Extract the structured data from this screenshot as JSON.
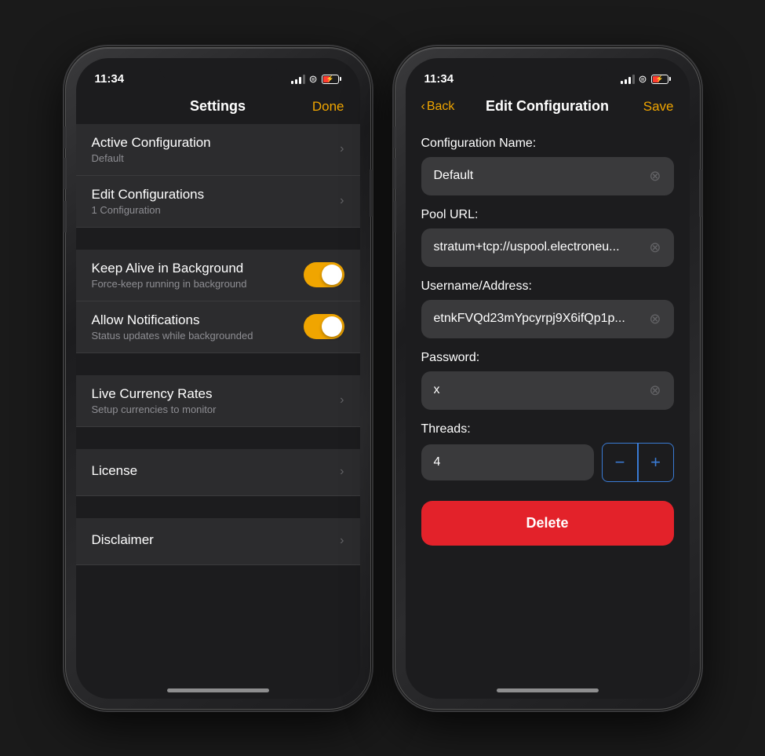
{
  "phone1": {
    "status": {
      "time": "11:34"
    },
    "nav": {
      "title": "Settings",
      "done_label": "Done"
    },
    "groups": [
      {
        "items": [
          {
            "title": "Active Configuration",
            "subtitle": "Default",
            "type": "nav"
          },
          {
            "title": "Edit Configurations",
            "subtitle": "1 Configuration",
            "type": "nav"
          }
        ]
      },
      {
        "items": [
          {
            "title": "Keep Alive in Background",
            "subtitle": "Force-keep running in background",
            "type": "toggle",
            "value": true
          },
          {
            "title": "Allow Notifications",
            "subtitle": "Status updates while backgrounded",
            "type": "toggle",
            "value": true
          }
        ]
      },
      {
        "items": [
          {
            "title": "Live Currency Rates",
            "subtitle": "Setup currencies to monitor",
            "type": "nav"
          }
        ]
      },
      {
        "items": [
          {
            "title": "License",
            "subtitle": "",
            "type": "nav"
          }
        ]
      },
      {
        "items": [
          {
            "title": "Disclaimer",
            "subtitle": "",
            "type": "nav"
          }
        ]
      }
    ]
  },
  "phone2": {
    "status": {
      "time": "11:34"
    },
    "nav": {
      "title": "Edit Configuration",
      "back_label": "Back",
      "save_label": "Save"
    },
    "form": {
      "config_name_label": "Configuration Name:",
      "config_name_value": "Default",
      "pool_url_label": "Pool URL:",
      "pool_url_value": "stratum+tcp://uspool.electroneu...",
      "username_label": "Username/Address:",
      "username_value": "etnkFVQd23mYpcyrpj9X6ifQp1p...",
      "password_label": "Password:",
      "password_value": "x",
      "threads_label": "Threads:",
      "threads_value": "4",
      "stepper_minus": "−",
      "stepper_plus": "+",
      "delete_label": "Delete"
    }
  }
}
